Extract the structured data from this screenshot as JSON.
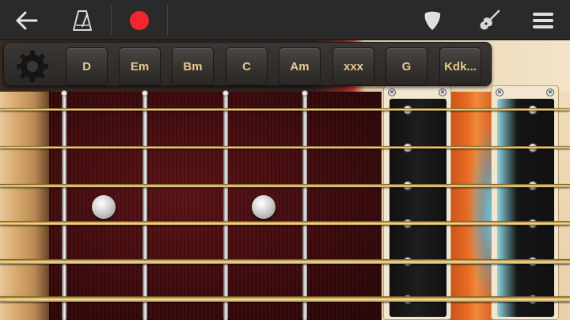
{
  "toolbar": {
    "back_icon": "arrow-left-icon",
    "metronome_icon": "metronome-icon",
    "record_icon": "record-icon",
    "pick_icon": "guitar-pick-icon",
    "guitar_icon": "guitar-icon",
    "menu_icon": "hamburger-menu-icon",
    "record_color": "#f2262b"
  },
  "chord_bar": {
    "settings_icon": "gear-icon",
    "chords": [
      "D",
      "Em",
      "Bm",
      "C",
      "Am",
      "xxx",
      "G",
      "Kdk..."
    ]
  },
  "fretboard": {
    "string_count": 6,
    "fret_count": 4,
    "inlay_count": 2,
    "glow_color": "#5adcff"
  },
  "pickups": [
    {
      "name": "pickup-neck",
      "pole_count": 6
    },
    {
      "name": "pickup-bridge",
      "pole_count": 6
    }
  ]
}
